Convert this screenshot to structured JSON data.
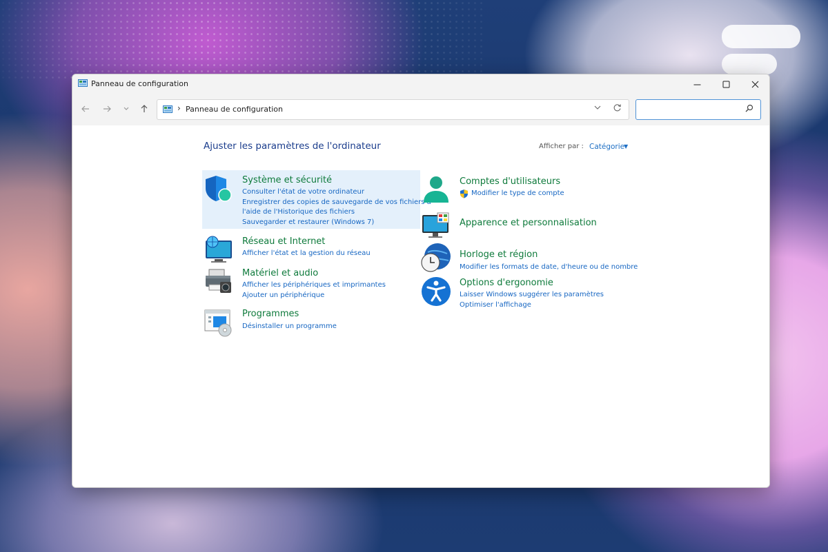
{
  "window": {
    "title": "Panneau de configuration"
  },
  "titlebar": {
    "minimize_icon": "minimize-icon",
    "maximize_icon": "maximize-icon",
    "close_icon": "close-icon"
  },
  "nav": {
    "back_icon": "back-arrow-icon",
    "forward_icon": "forward-arrow-icon",
    "recent_icon": "chevron-down-icon",
    "up_icon": "up-arrow-icon"
  },
  "address": {
    "path": "Panneau de configuration",
    "separator": "›"
  },
  "search": {
    "value": "",
    "placeholder": ""
  },
  "content": {
    "heading": "Ajuster les paramètres de l'ordinateur",
    "view_by_label": "Afficher par :",
    "view_by_value": "Catégorie"
  },
  "categories_left": [
    {
      "title": "Système et sécurité",
      "links": [
        "Consulter l'état de votre ordinateur",
        "Enregistrer des copies de sauvegarde de vos fichiers à",
        "l'aide de l'Historique des fichiers",
        "Sauvegarder et restaurer (Windows 7)"
      ],
      "icon": "shield-icon"
    },
    {
      "title": "Réseau et Internet",
      "links": [
        "Afficher l'état et la gestion du réseau"
      ],
      "icon": "network-globe-icon"
    },
    {
      "title": "Matériel et audio",
      "links": [
        "Afficher les périphériques et imprimantes",
        "Ajouter un périphérique"
      ],
      "icon": "printer-icon"
    },
    {
      "title": "Programmes",
      "links": [
        "Désinstaller un programme"
      ],
      "icon": "programs-icon"
    }
  ],
  "categories_right": [
    {
      "title": "Comptes d'utilisateurs",
      "links": [
        "Modifier le type de compte"
      ],
      "icon": "user-icon"
    },
    {
      "title": "Apparence et personnalisation",
      "links": [],
      "icon": "monitor-palette-icon"
    },
    {
      "title": "Horloge et région",
      "links": [
        "Modifier les formats de date, d'heure ou de nombre"
      ],
      "icon": "clock-globe-icon"
    },
    {
      "title": "Options d'ergonomie",
      "links": [
        "Laisser Windows suggérer les paramètres",
        "Optimiser l'affichage"
      ],
      "icon": "accessibility-icon"
    }
  ],
  "colors": {
    "heading": "#1a3c8c",
    "category_title": "#0e7a3b",
    "link": "#1666c2",
    "highlight": "#e4f0fb",
    "search_border": "#4f92d6"
  }
}
